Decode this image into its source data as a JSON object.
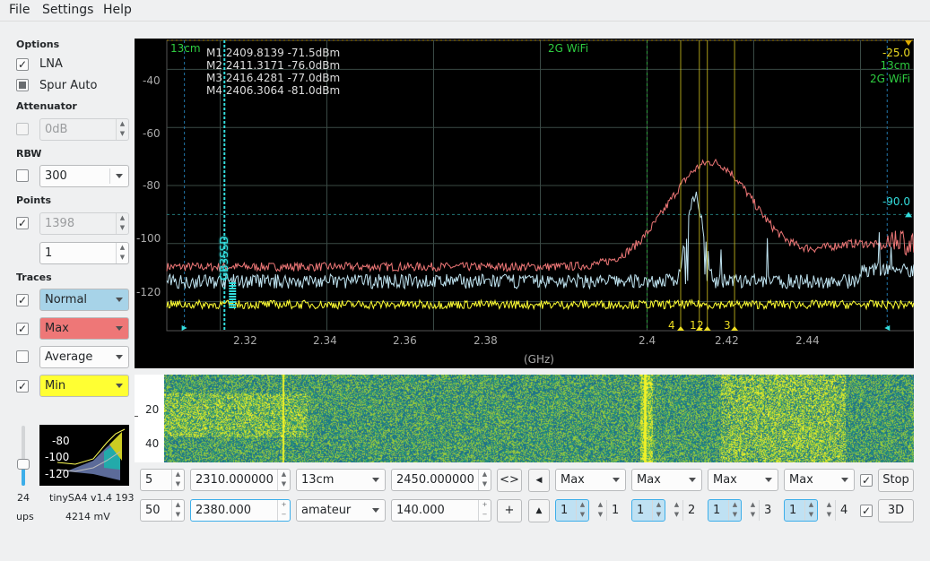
{
  "menu": [
    "File",
    "Settings",
    "Help"
  ],
  "sidebar": {
    "options_label": "Options",
    "lna_label": "LNA",
    "lna_checked": true,
    "spur_label": "Spur Auto",
    "attenuator_label": "Attenuator",
    "attenuator_value": "0dB",
    "rbw_label": "RBW",
    "rbw_value": "300",
    "points_label": "Points",
    "points_value": "1398",
    "points_step": "1",
    "traces_label": "Traces",
    "traces": [
      {
        "label": "Normal",
        "checked": true,
        "color": "#a7d3e8"
      },
      {
        "label": "Max",
        "checked": true,
        "color": "#ee7777"
      },
      {
        "label": "Average",
        "checked": false,
        "color": "#fcfcfc"
      },
      {
        "label": "Min",
        "checked": true,
        "color": "#ffff33"
      }
    ],
    "rate": "24",
    "rate_unit": "ups",
    "device": "tinySA4 v1.4 193",
    "voltage": "4214 mV",
    "mini_ticks": [
      "-80",
      "-100",
      "-120"
    ]
  },
  "graph": {
    "markers": [
      {
        "id": "M1",
        "freq": "2409.8139",
        "level": "-71.5dBm"
      },
      {
        "id": "M2",
        "freq": "2411.3171",
        "level": "-76.0dBm"
      },
      {
        "id": "M3",
        "freq": "2416.4281",
        "level": "-77.0dBm"
      },
      {
        "id": "M4",
        "freq": "2406.3064",
        "level": "-81.0dBm"
      }
    ],
    "band_left": "13cm",
    "band_mid": "2G WiFi",
    "band_right_top": "-25.0",
    "band_right_1": "13cm",
    "band_right_2": "2G WiFi",
    "ref_level": "-90.0",
    "beacon": "GB3SSD",
    "marker_nums": [
      "4",
      "1",
      "2",
      "3"
    ],
    "y_ticks": [
      "-40",
      "-60",
      "-80",
      "-100",
      "-120"
    ],
    "x_ticks": [
      "2.32",
      "2.34",
      "2.36",
      "2.38",
      "2.4",
      "2.42",
      "2.44"
    ],
    "x_unit": "(GHz)",
    "wf_ticks": [
      "20",
      "40"
    ]
  },
  "controls": {
    "row1": {
      "step": "5",
      "start": "2310.000000",
      "band": "13cm",
      "stop": "2450.000000",
      "swap": "<>",
      "m1": "Max",
      "m2": "Max",
      "m3": "Max",
      "m4": "Max",
      "stop_btn": "Stop"
    },
    "row2": {
      "avg": "50",
      "center": "2380.000",
      "preset": "amateur",
      "span": "140.000",
      "plus": "+",
      "ma": [
        "1",
        "1",
        "1",
        "1"
      ],
      "mb": [
        "1",
        "2",
        "3",
        "4"
      ],
      "btn3d": "3D"
    }
  },
  "colors": {
    "grid": "#3a4a45",
    "trace_max": "#ee7777",
    "trace_normal": "#bfe3f0",
    "trace_min": "#ffff33",
    "band": "#2ecc40",
    "marker": "#eedd22",
    "cyan": "#33dddd"
  }
}
